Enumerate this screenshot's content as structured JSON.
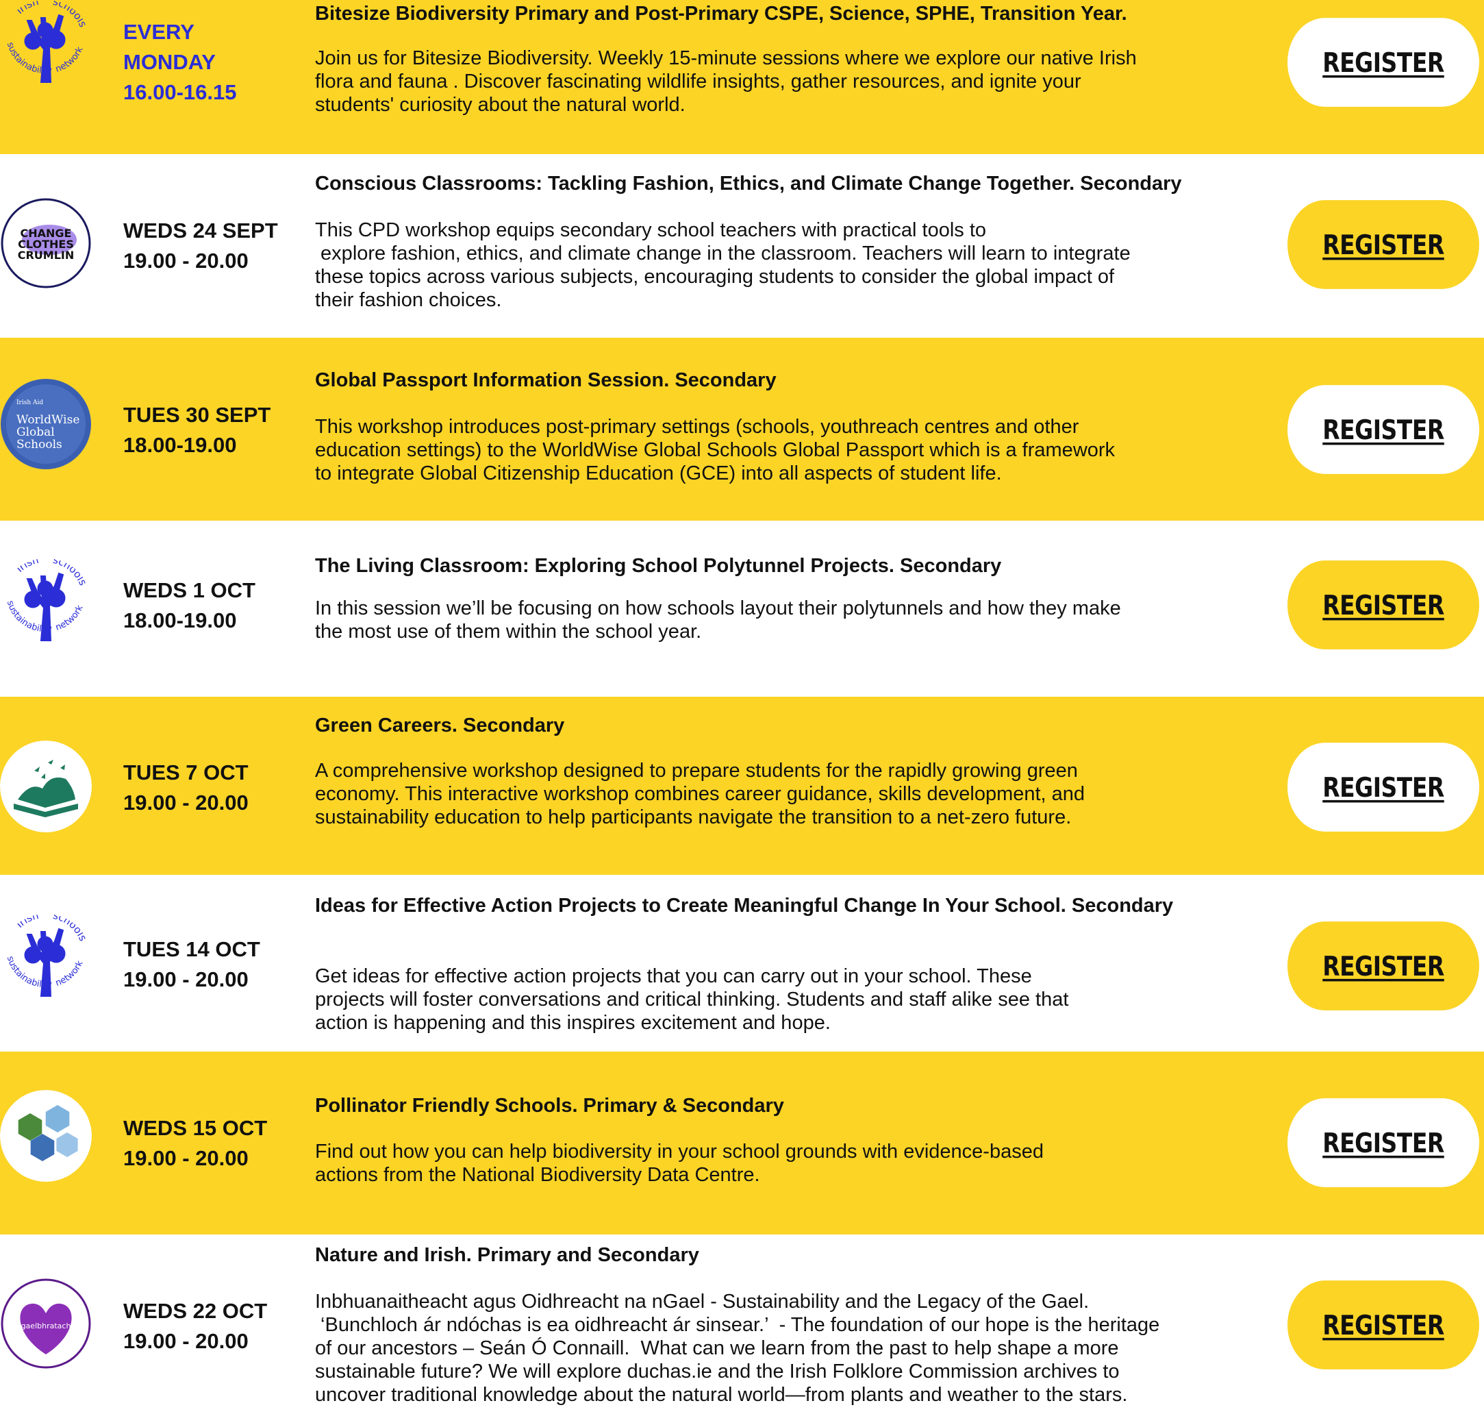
{
  "colors": {
    "yellow": "#fbd426",
    "white": "#ffffff",
    "blue": "#2b2ed6",
    "text": "#111111"
  },
  "events": [
    {
      "band": "yellow",
      "button_style": "white",
      "date_color": "blue",
      "logo": "tree",
      "logo_text": [
        "Irish",
        "schools",
        "sustainability",
        "network"
      ],
      "date_lines": [
        "EVERY",
        "MONDAY",
        "16.00-16.15"
      ],
      "title": "Bitesize Biodiversity  Primary and Post-Primary CSPE, Science, SPHE, Transition Year.",
      "desc_lines": [
        "Join us for Bitesize Biodiversity. Weekly 15-minute sessions where we explore our native Irish",
        "flora and fauna . Discover fascinating wildlife insights, gather resources, and ignite your",
        "students' curiosity about the natural world."
      ],
      "register": "REGISTER"
    },
    {
      "band": "white",
      "button_style": "yellow",
      "date_color": "dark",
      "logo": "change",
      "logo_text": [
        "CHANGE",
        "CLOTHES",
        "CRUMLIN"
      ],
      "date_lines": [
        "WEDS 24 SEPT",
        "19.00 - 20.00"
      ],
      "title": "Conscious Classrooms: Tackling Fashion, Ethics, and Climate Change Together. Secondary",
      "desc_lines": [
        "This CPD workshop equips secondary school teachers with practical tools to",
        " explore fashion, ethics, and climate change in the classroom. Teachers will learn to integrate",
        "these topics across various subjects, encouraging students to consider the global impact of",
        "their fashion choices."
      ],
      "register": "REGISTER"
    },
    {
      "band": "yellow",
      "button_style": "white",
      "date_color": "dark",
      "logo": "worldwise",
      "logo_text": [
        "Irish Aid",
        "WorldWise",
        "Global",
        "Schools"
      ],
      "date_lines": [
        "TUES 30 SEPT",
        "18.00-19.00"
      ],
      "title": "Global Passport Information Session. Secondary",
      "desc_lines": [
        "This workshop introduces post-primary settings (schools, youthreach centres and other",
        "education settings) to the WorldWise Global Schools Global Passport which is a framework",
        "to integrate Global Citizenship Education (GCE) into all aspects of student life."
      ],
      "register": "REGISTER"
    },
    {
      "band": "white",
      "button_style": "yellow",
      "date_color": "dark",
      "logo": "tree",
      "logo_text": [
        "Irish",
        "schools",
        "sustainability",
        "network"
      ],
      "date_lines": [
        "WEDS 1 OCT",
        "18.00-19.00"
      ],
      "title": "The Living Classroom: Exploring School Polytunnel Projects. Secondary",
      "desc_lines": [
        "In this session we’ll be focusing on how schools layout their polytunnels and how they make",
        "the most use of them within the school year."
      ],
      "register": "REGISTER"
    },
    {
      "band": "yellow",
      "button_style": "white",
      "date_color": "dark",
      "logo": "book",
      "logo_text": [],
      "date_lines": [
        "TUES 7 OCT",
        "19.00 - 20.00"
      ],
      "title": "Green Careers. Secondary",
      "desc_lines": [
        "A comprehensive workshop designed to prepare students for the rapidly growing green",
        "economy. This interactive workshop combines career guidance, skills development, and",
        "sustainability education to help participants navigate the transition to a net-zero future."
      ],
      "register": "REGISTER"
    },
    {
      "band": "white",
      "button_style": "yellow",
      "date_color": "dark",
      "logo": "tree",
      "logo_text": [
        "Irish",
        "schools",
        "sustainability",
        "network"
      ],
      "date_lines": [
        "TUES 14 OCT",
        "19.00 - 20.00"
      ],
      "title": "Ideas for Effective Action Projects to Create Meaningful Change In Your School. Secondary",
      "desc_lines": [
        "Get ideas for effective action projects that you can carry out in your school. These",
        "projects will foster conversations and critical thinking. Students and staff alike see that",
        "action is happening and this inspires excitement and hope."
      ],
      "register": "REGISTER"
    },
    {
      "band": "yellow",
      "button_style": "white",
      "date_color": "dark",
      "logo": "hex",
      "logo_text": [],
      "date_lines": [
        "WEDS 15 OCT",
        "19.00 - 20.00"
      ],
      "title": "Pollinator Friendly Schools. Primary & Secondary",
      "desc_lines": [
        "Find out how you can help biodiversity in your school grounds with evidence-based",
        "actions from the National Biodiversity Data Centre."
      ],
      "register": "REGISTER"
    },
    {
      "band": "white",
      "button_style": "yellow",
      "date_color": "dark",
      "logo": "heart",
      "logo_text": [
        "gaelbhratach"
      ],
      "date_lines": [
        "WEDS 22 OCT",
        "19.00 - 20.00"
      ],
      "title": "Nature and Irish. Primary and Secondary",
      "desc_lines": [
        "Inbhuanaitheacht agus Oidhreacht na nGael - Sustainability and the Legacy of the Gael.",
        " ‘Bunchloch ár ndóchas is ea oidhreacht ár sinsear.’  - The foundation of our hope is the heritage",
        "of our ancestors – Seán Ó Connaill.  What can we learn from the past to help shape a more",
        "sustainable future? We will explore duchas.ie and the Irish Folklore Commission archives to",
        "uncover traditional knowledge about the natural world—from plants and weather to the stars."
      ],
      "register": "REGISTER"
    }
  ]
}
